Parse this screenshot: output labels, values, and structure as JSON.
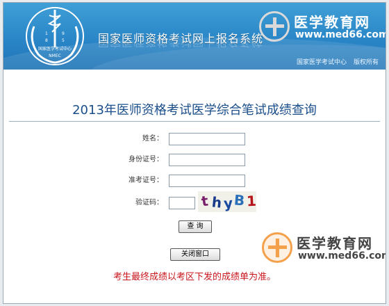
{
  "header": {
    "title": "国家医师资格考试网上报名系统",
    "emblem": {
      "year_left": "1",
      "year_right": "9",
      "year_bottom_left": "8",
      "year_bottom_right": "5",
      "org_name": "国家医学考试中心",
      "abbr": "NMEC"
    },
    "copyright": {
      "owner": "国家医学考试中心",
      "rights": "版权所有"
    },
    "colors": {
      "top": "#3f9fd6",
      "bottom": "#1f74b6"
    }
  },
  "watermark": {
    "title": "医学教育网",
    "url": "www.med66.com",
    "colors": {
      "top_title": "#ffffff",
      "top_circle": "#d9d9d9",
      "bottom_title": "#444444",
      "bottom_circle": "#f5a04a"
    }
  },
  "page": {
    "heading": "2013年医师资格考试医学综合笔试成绩查询"
  },
  "form": {
    "name_label": "姓名：",
    "name_value": "",
    "id_label": "身份证号：",
    "id_value": "",
    "ticket_label": "准考证号：",
    "ticket_value": "",
    "captcha_label": "验证码：",
    "captcha_value": "",
    "captcha_text": "thyB1",
    "captcha_chars": [
      "t",
      "h",
      "y",
      "B",
      "1"
    ],
    "captcha_colors": [
      "#7a1f6b",
      "#1a3a8a",
      "#1a4aa0",
      "#2b6fb8",
      "#b5151a"
    ],
    "query_button": "查 询",
    "close_button": "关闭窗口"
  },
  "notice": "考生最终成绩以考区下发的成绩单为准。"
}
